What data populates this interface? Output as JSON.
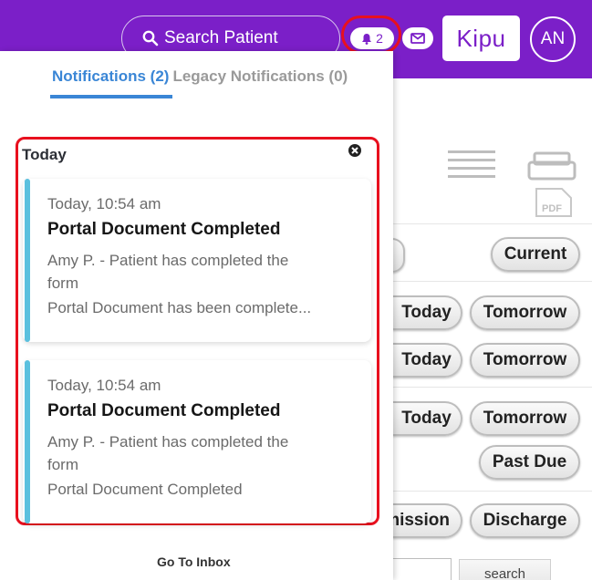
{
  "header": {
    "search_label": "Search Patient",
    "notification_count": "2",
    "logo_text": "Kipu",
    "avatar_initials": "AN",
    "brand_color": "#7b1fc8"
  },
  "notifications_panel": {
    "tabs": [
      {
        "label": "Notifications (2)",
        "active": true
      },
      {
        "label": "Legacy Notifications (0)",
        "active": false
      }
    ],
    "section_label": "Today",
    "items": [
      {
        "time": "Today, 10:54 am",
        "title": "Portal Document Completed",
        "subtitle": "Amy P. - Patient has completed the form",
        "body": "Portal Document has been complete..."
      },
      {
        "time": "Today, 10:54 am",
        "title": "Portal Document Completed",
        "subtitle": "Amy P. - Patient has completed the form",
        "body": "Portal Document Completed"
      }
    ],
    "go_to_inbox": "Go To Inbox",
    "accent_color": "#5bc0de",
    "tab_color": "#3a86d6"
  },
  "background_page": {
    "buttons": {
      "current": "Current",
      "today_1": "Today",
      "tomorrow_1": "Tomorrow",
      "today_2": "Today",
      "tomorrow_2": "Tomorrow",
      "today_3": "Today",
      "tomorrow_3": "Tomorrow",
      "past_due": "Past Due",
      "admission_partial": "mission",
      "discharge": "Discharge"
    },
    "search_button": "search",
    "pdf_label": "PDF"
  },
  "highlight_color": "#e8101e"
}
